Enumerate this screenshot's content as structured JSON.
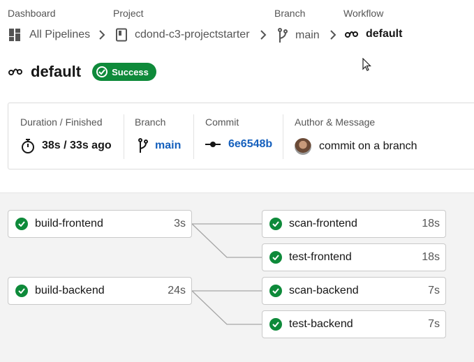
{
  "breadcrumb": {
    "dashboard": {
      "label": "Dashboard",
      "link": "All Pipelines"
    },
    "project": {
      "label": "Project",
      "link": "cdond-c3-projectstarter"
    },
    "branch": {
      "label": "Branch",
      "link": "main"
    },
    "workflow": {
      "label": "Workflow",
      "link": "default"
    }
  },
  "header": {
    "title": "default",
    "status": "Success",
    "status_color": "#0e8a3a"
  },
  "summary": {
    "duration": {
      "label": "Duration / Finished",
      "value": "38s / 33s ago"
    },
    "branch": {
      "label": "Branch",
      "value": "main"
    },
    "commit": {
      "label": "Commit",
      "value": "6e6548b"
    },
    "author": {
      "label": "Author & Message",
      "message": "commit on a branch"
    }
  },
  "jobs": {
    "build_frontend": {
      "name": "build-frontend",
      "duration": "3s"
    },
    "build_backend": {
      "name": "build-backend",
      "duration": "24s"
    },
    "scan_frontend": {
      "name": "scan-frontend",
      "duration": "18s"
    },
    "test_frontend": {
      "name": "test-frontend",
      "duration": "18s"
    },
    "scan_backend": {
      "name": "scan-backend",
      "duration": "7s"
    },
    "test_backend": {
      "name": "test-backend",
      "duration": "7s"
    }
  },
  "icons": {
    "pipelines": "grid-icon",
    "project": "book-icon",
    "branch": "branch-icon",
    "workflow": "workflow-icon",
    "timer": "stopwatch-icon",
    "commit": "commit-icon",
    "status": "check-circle-icon"
  }
}
